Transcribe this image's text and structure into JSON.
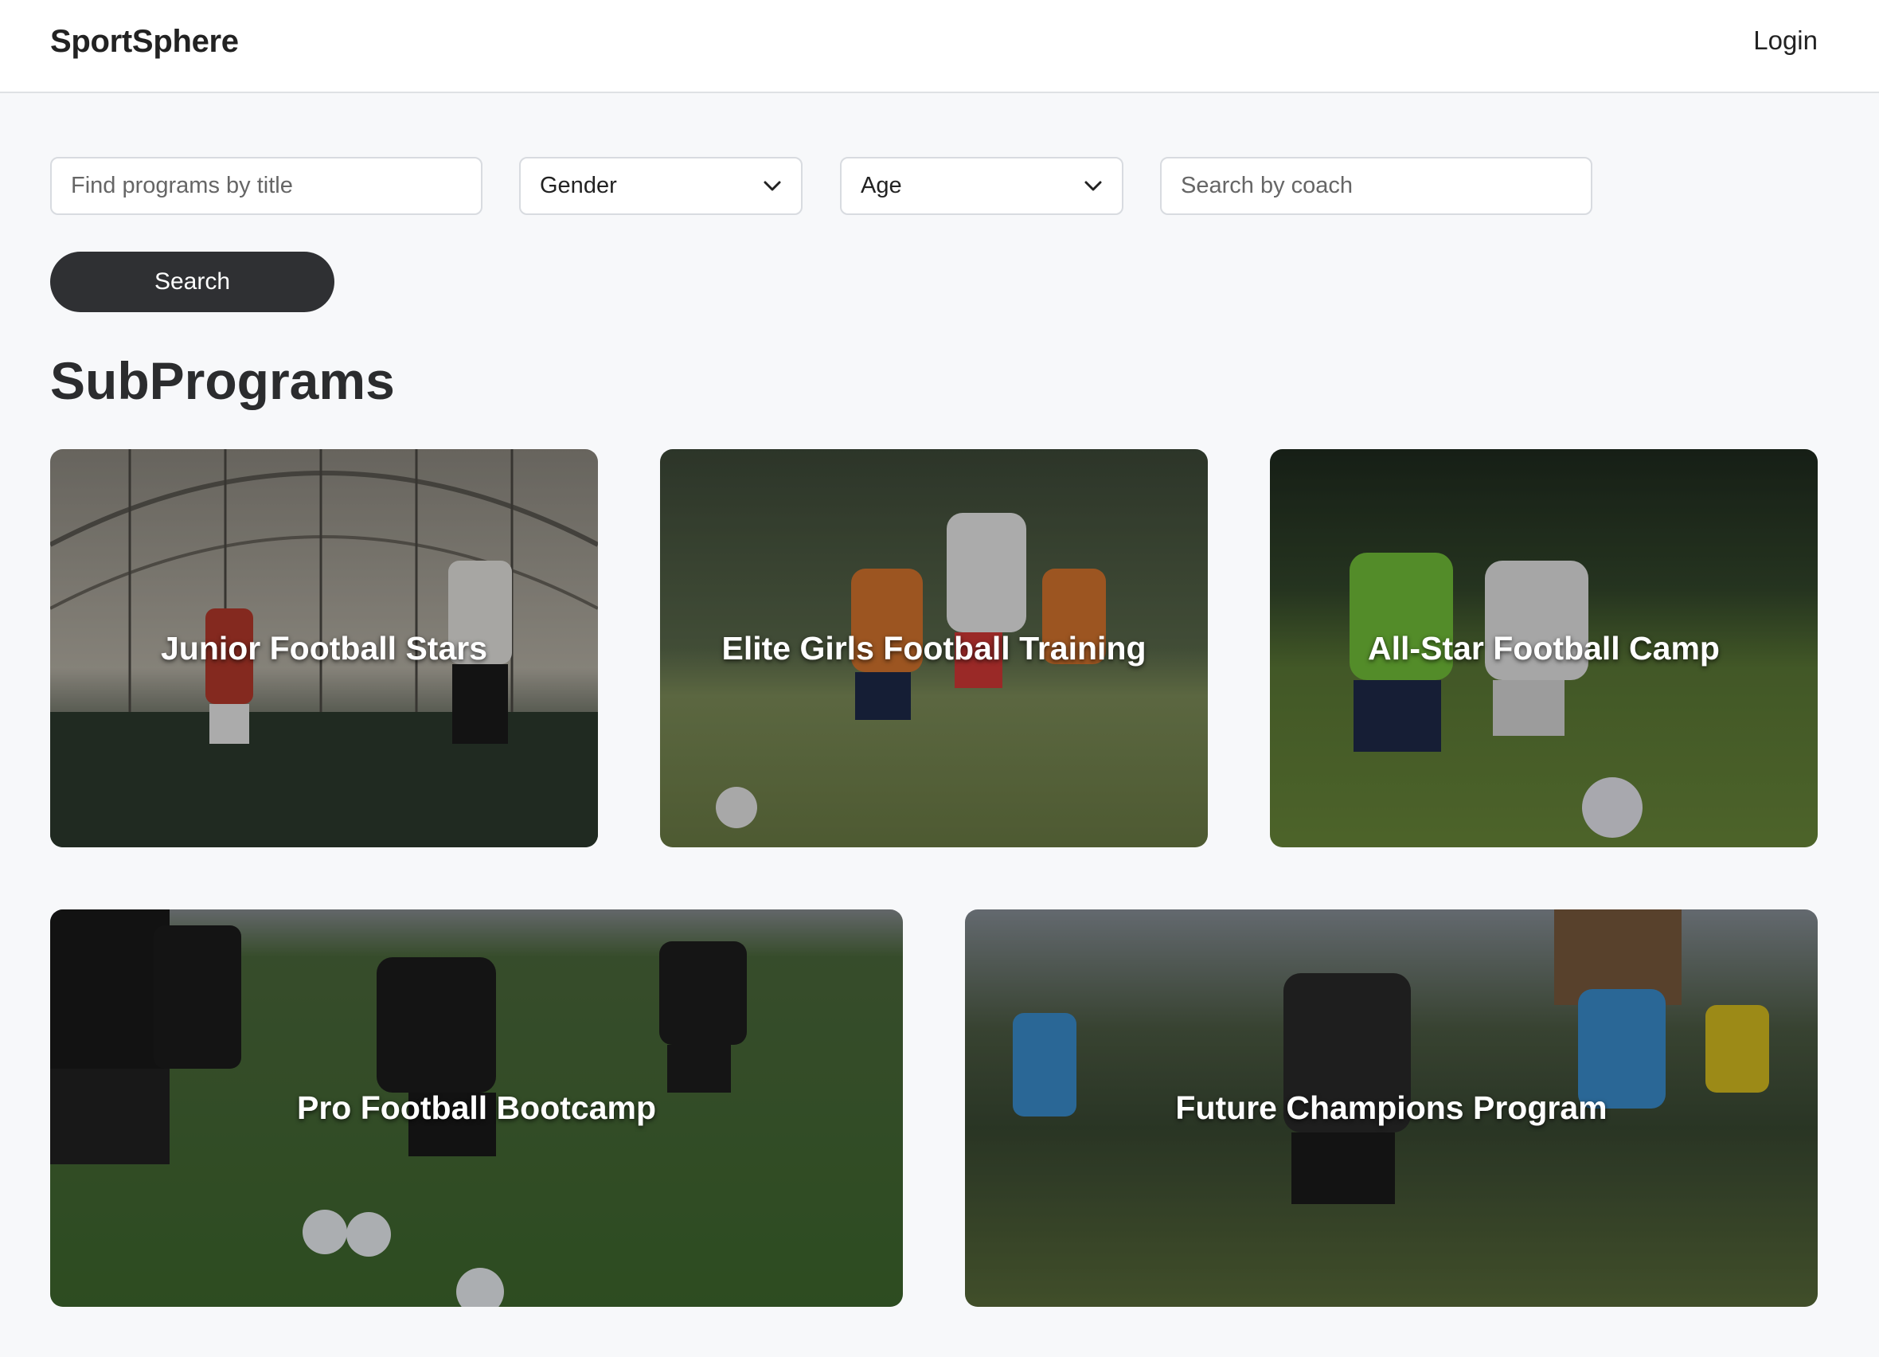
{
  "header": {
    "brand": "SportSphere",
    "login_label": "Login"
  },
  "filters": {
    "title_placeholder": "Find programs by title",
    "gender_label": "Gender",
    "age_label": "Age",
    "coach_placeholder": "Search by coach",
    "search_label": "Search"
  },
  "section": {
    "title": "SubPrograms"
  },
  "programs": [
    {
      "title": "Junior Football Stars",
      "image": "indoor-dome-football-training"
    },
    {
      "title": "Elite Girls Football Training",
      "image": "girls-football-match"
    },
    {
      "title": "All-Star Football Camp",
      "image": "kids-football-duel"
    },
    {
      "title": "Pro Football Bootcamp",
      "image": "pro-players-warmup"
    },
    {
      "title": "Future Champions Program",
      "image": "youth-football-match"
    }
  ]
}
